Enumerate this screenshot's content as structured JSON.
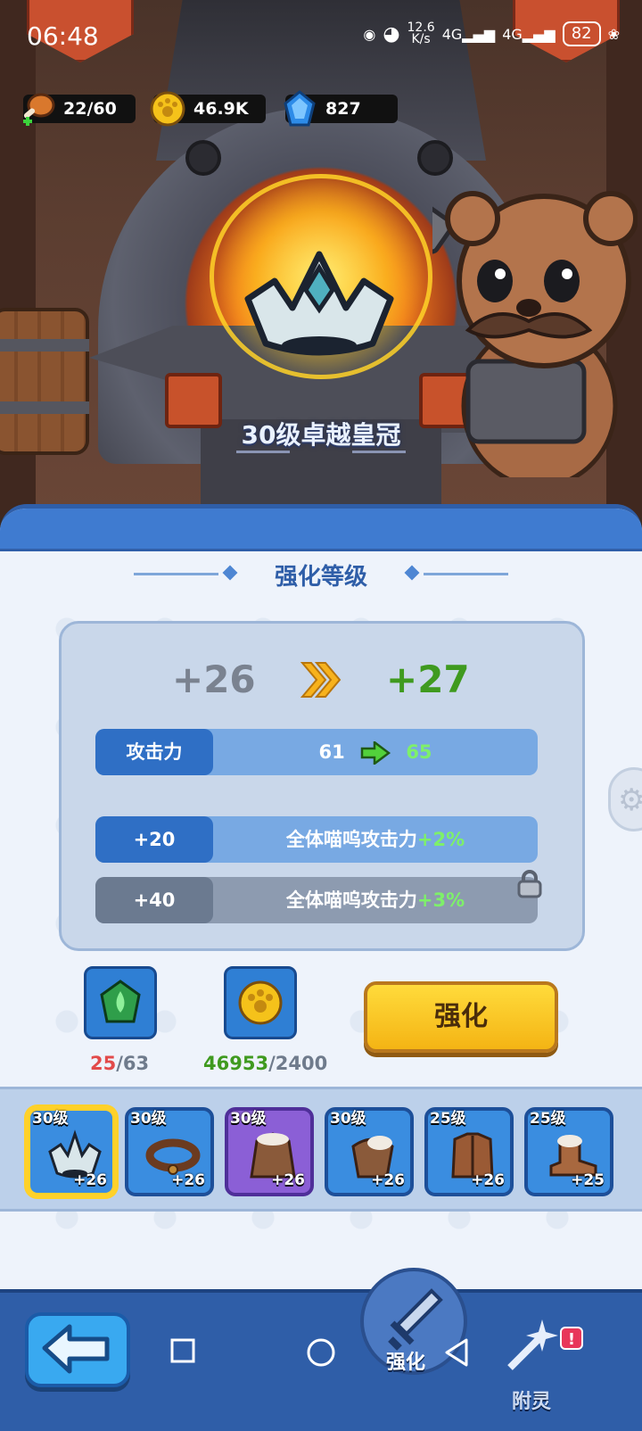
{
  "status_bar": {
    "time": "06:48",
    "network_speed_value": "12.6",
    "network_speed_unit": "K/s",
    "sim1": "4G",
    "sim2": "4G",
    "battery": "82"
  },
  "resources": {
    "stamina": "22/60",
    "gold": "46.9K",
    "gems": "827"
  },
  "scene": {
    "item_name": "30级卓越皇冠"
  },
  "panel": {
    "section_title": "强化等级",
    "level_from": "+26",
    "level_to": "+27",
    "stat": {
      "label": "攻击力",
      "from": "61",
      "to": "65"
    },
    "bonuses": [
      {
        "tag": "+20",
        "text": "全体喵呜攻击力",
        "value": "+2%",
        "locked": false
      },
      {
        "tag": "+40",
        "text": "全体喵呜攻击力",
        "value": "+3%",
        "locked": true
      }
    ],
    "costs": [
      {
        "icon": "enhance-stone-icon",
        "have": "25",
        "need": "/63",
        "enough": false
      },
      {
        "icon": "gold-coin-icon",
        "have": "46953",
        "need": "/2400",
        "enough": true
      }
    ],
    "enhance_button": "强化"
  },
  "equipment": [
    {
      "level": "30级",
      "plus": "+26",
      "icon": "crown-icon",
      "rarity": "blue",
      "selected": true
    },
    {
      "level": "30级",
      "plus": "+26",
      "icon": "collar-icon",
      "rarity": "blue",
      "selected": false
    },
    {
      "level": "30级",
      "plus": "+26",
      "icon": "coat-icon",
      "rarity": "purple",
      "selected": false
    },
    {
      "level": "30级",
      "plus": "+26",
      "icon": "cape-icon",
      "rarity": "blue",
      "selected": false
    },
    {
      "level": "25级",
      "plus": "+26",
      "icon": "jacket-icon",
      "rarity": "blue",
      "selected": false
    },
    {
      "level": "25级",
      "plus": "+25",
      "icon": "boot-icon",
      "rarity": "blue",
      "selected": false
    }
  ],
  "bottom_nav": {
    "tab_enhance": "强化",
    "tab_enchant": "附灵",
    "enchant_badge": "!"
  },
  "colors": {
    "accent_blue": "#2f5ea8",
    "highlight_green": "#3f9a1f",
    "warning_red": "#e24a4a",
    "button_yellow": "#f4b414"
  }
}
